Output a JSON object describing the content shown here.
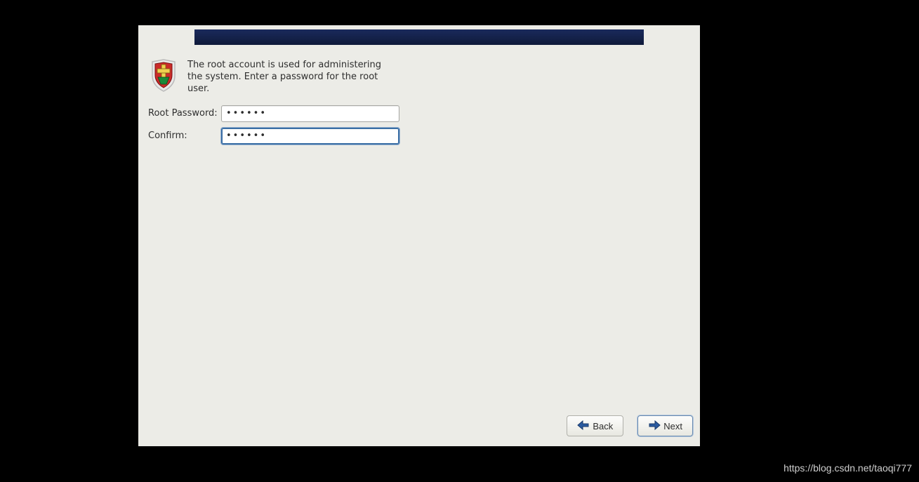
{
  "intro": {
    "text": "The root account is used for administering the system.  Enter a password for the root user."
  },
  "form": {
    "password_label": "Root Password:",
    "confirm_label": "Confirm:",
    "password_value": "••••••",
    "confirm_value": "••••••"
  },
  "buttons": {
    "back": "Back",
    "next": "Next"
  },
  "watermark": "https://blog.csdn.net/taoqi777"
}
